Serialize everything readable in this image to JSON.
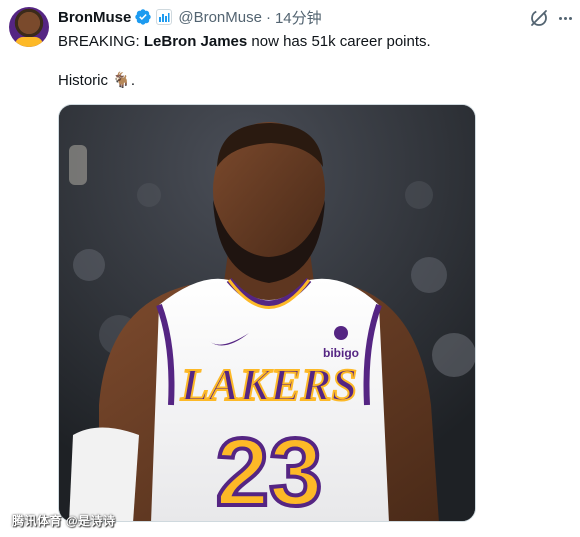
{
  "tweet": {
    "display_name": "BronMuse",
    "handle": "@BronMuse",
    "separator": "·",
    "time": "14分钟",
    "line1": {
      "prefix": "BREAKING: ",
      "name": "LeBron James",
      "suffix": " now has 51k career points."
    },
    "line2": {
      "text": "Historic ",
      "emoji": "🐐",
      "end": "."
    },
    "photo": {
      "jersey_team": "LAKERS",
      "jersey_number": "23",
      "sponsor": "bibigo"
    }
  },
  "watermark": "腾讯体育 @是诗诗",
  "colors": {
    "text_primary": "#0f1419",
    "text_secondary": "#536471",
    "verified_blue": "#1d9bf0",
    "lakers_purple": "#552583",
    "lakers_gold": "#fdb927"
  },
  "icons": [
    "verified-badge-icon",
    "affiliate-badge-icon",
    "grok-icon",
    "more-icon",
    "goat-emoji"
  ]
}
